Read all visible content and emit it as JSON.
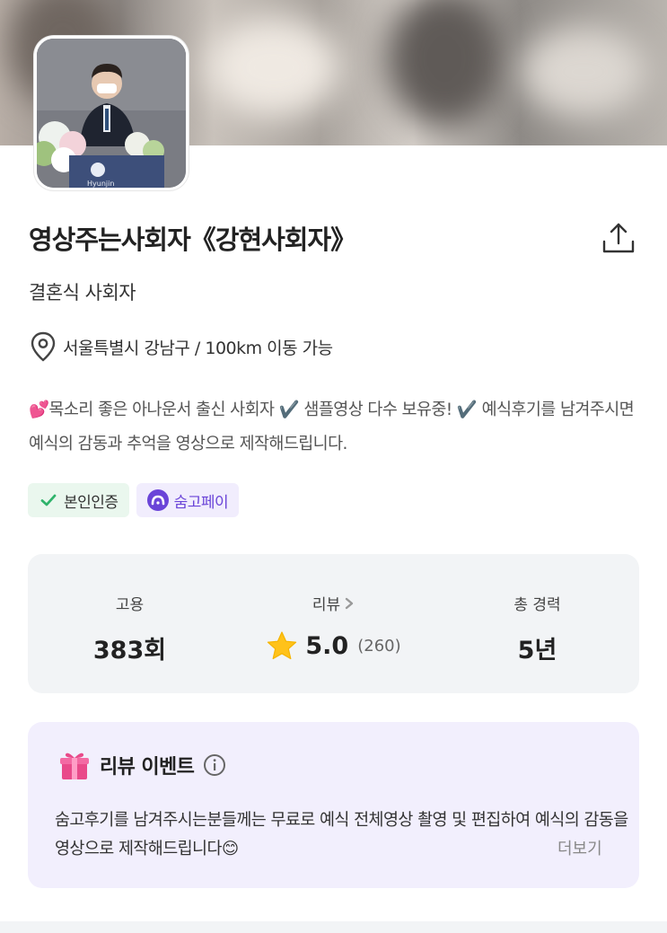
{
  "profile": {
    "name": "영상주는사회자《강현사회자》",
    "category": "결혼식 사회자",
    "location": "서울특별시 강남구 / 100km 이동 가능",
    "intro": "💕목소리 좋은 아나운서 출신 사회자 ✔️ 샘플영상 다수 보유중! ✔️ 예식후기를 남겨주시면 예식의 감동과 추억을 영상으로 제작해드립니다.",
    "avatar_caption": "Hyunjin"
  },
  "badges": {
    "verified": "본인인증",
    "pay": "숨고페이"
  },
  "stats": {
    "hire_label": "고용",
    "hire_value": "383회",
    "review_label": "리뷰",
    "review_score": "5.0",
    "review_count": "(260)",
    "career_label": "총 경력",
    "career_value": "5년"
  },
  "event": {
    "title": "리뷰 이벤트",
    "text": "숨고후기를 남겨주시는분들께는 무료로 예식 전체영상 촬영 및 편집하여 예식의 감동을 영상으로 제작해드립니다😊",
    "more": "더보기"
  },
  "icons": {
    "share": "share-icon",
    "location": "location-pin-icon",
    "check": "check-icon",
    "pay": "pay-logo-icon",
    "chevron": "chevron-right-icon",
    "star": "star-icon",
    "gift": "gift-icon",
    "info": "info-icon"
  },
  "colors": {
    "accent_purple": "#6a44d8",
    "green_check": "#2fb36b",
    "star": "#ffc21a",
    "card_gray": "#f2f4f6",
    "event_bg": "#f2effd"
  }
}
